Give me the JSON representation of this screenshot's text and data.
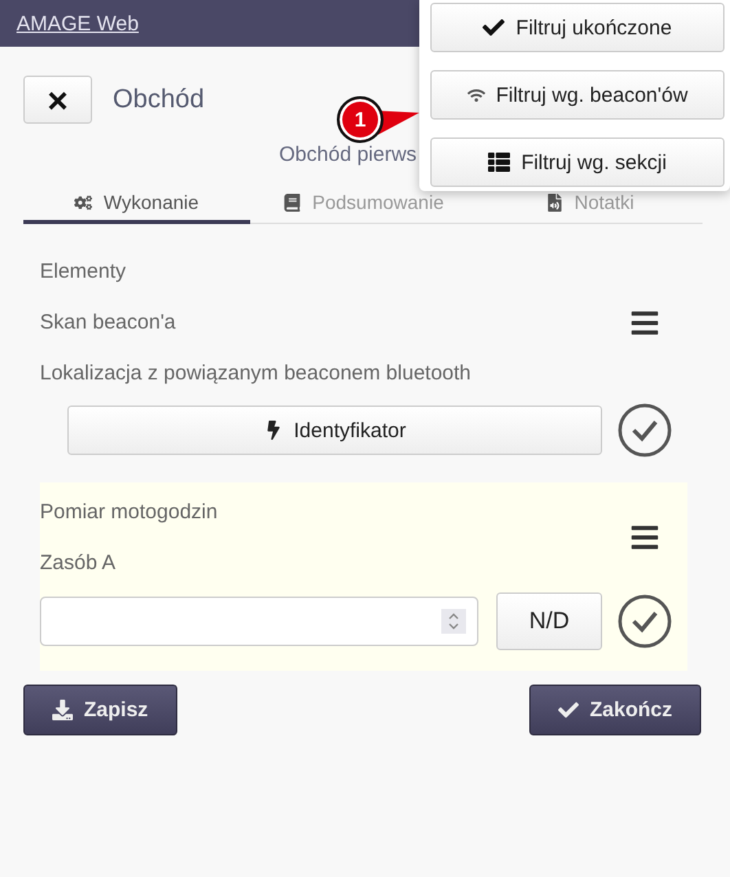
{
  "header": {
    "title": "AMAGE Web"
  },
  "page": {
    "close_label": "×",
    "title": "Obchód",
    "subtitle": "Obchód pierws"
  },
  "tabs": [
    {
      "label": "Wykonanie",
      "selected": true
    },
    {
      "label": "Podsumowanie",
      "selected": false
    },
    {
      "label": "Notatki",
      "selected": false
    }
  ],
  "sections": [
    {
      "kind": "button",
      "lines": [
        "Elementy",
        "Skan beacon'a",
        "Lokalizacja z powiązanym beaconem bluetooth"
      ],
      "action": "Identyfikator"
    },
    {
      "kind": "number",
      "lines": [
        "Pomiar motogodzin",
        "Zasób A"
      ],
      "action": "N/D"
    }
  ],
  "footer": {
    "save": "Zapisz",
    "finish": "Zakończ"
  },
  "menu": [
    {
      "label": "Filtruj ukończone"
    },
    {
      "label": "Filtruj wg. beacon'ów"
    },
    {
      "label": "Filtruj wg. sekcji"
    }
  ],
  "badge": {
    "label": "1"
  }
}
